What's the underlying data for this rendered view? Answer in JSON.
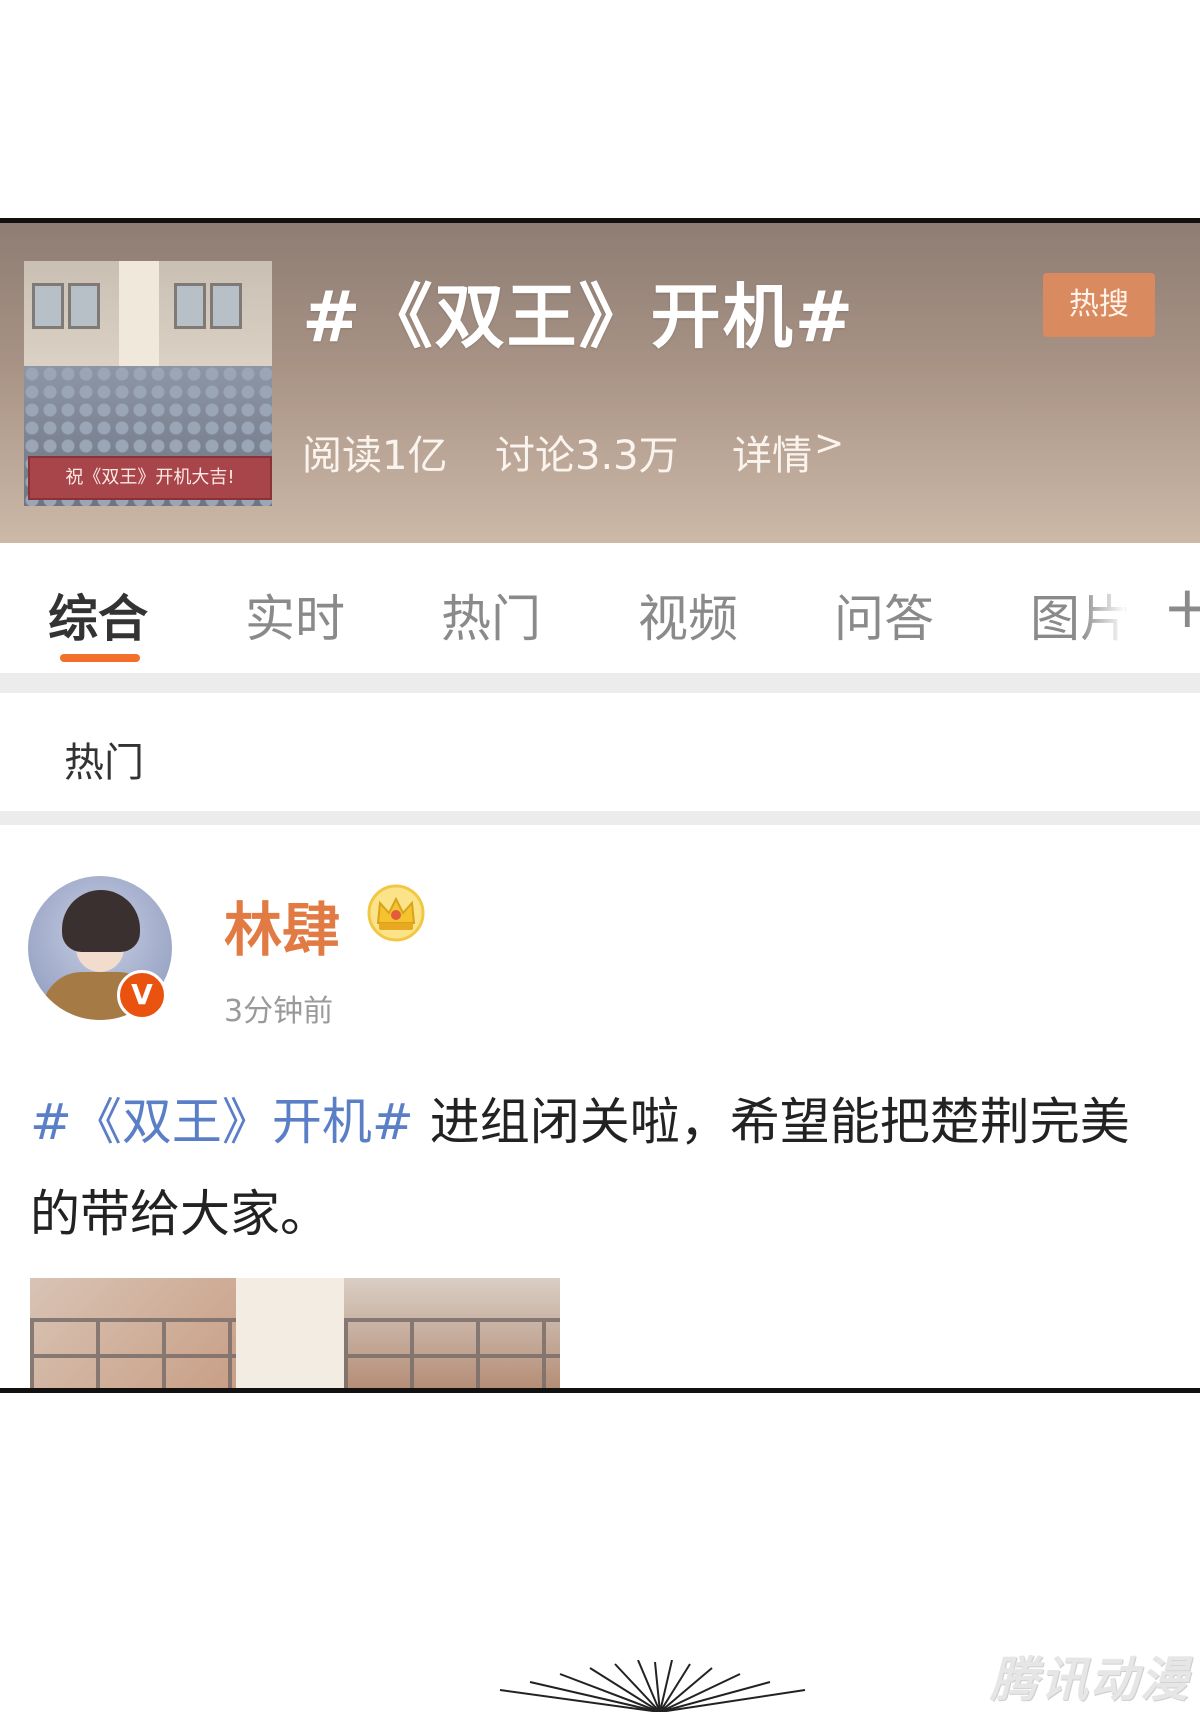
{
  "topic": {
    "title": "#《双王》开机#",
    "hot_badge": "热搜",
    "cover_caption": "祝《双王》开机大吉!",
    "stats": {
      "reads": "阅读1亿",
      "discussions": "讨论3.3万",
      "details": "详情",
      "details_arrow": ">"
    }
  },
  "tabs": [
    {
      "label": "综合",
      "active": true
    },
    {
      "label": "实时",
      "active": false
    },
    {
      "label": "热门",
      "active": false
    },
    {
      "label": "视频",
      "active": false
    },
    {
      "label": "问答",
      "active": false
    },
    {
      "label": "图片",
      "active": false
    }
  ],
  "tabs_more": "+",
  "section": {
    "label": "热门"
  },
  "post": {
    "username": "林肆",
    "verified_badge": "V",
    "timestamp": "3分钟前",
    "hashtag": "#《双王》开机#",
    "text": " 进组闭关啦，希望能把楚荆完美的带给大家。"
  },
  "icons": {
    "verified": "verified-v-icon",
    "crown": "crown-icon",
    "chevron": "chevron-right-icon",
    "more": "plus-icon"
  },
  "colors": {
    "accent": "#f36f2a",
    "username": "#e27a44",
    "hashtag": "#5b7fc7",
    "hot_badge": "#d98a5f"
  },
  "watermark": "腾讯动漫"
}
